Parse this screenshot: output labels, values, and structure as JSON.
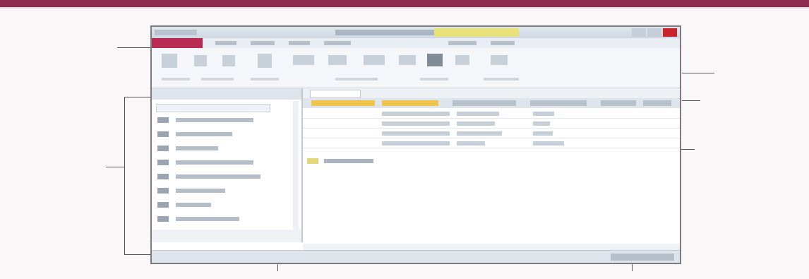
{
  "window": {
    "title": "",
    "file_tab": "",
    "ribbon_tabs": [
      "",
      "",
      "",
      "",
      "",
      ""
    ],
    "window_buttons": [
      "minimize",
      "maximize",
      "close"
    ]
  },
  "annotations": {
    "top_left": "",
    "top_right": "",
    "file_tab": "",
    "ribbon": "",
    "document_tab": "",
    "navigation_pane": "",
    "datasheet": "",
    "status_bar": "",
    "view_buttons": ""
  },
  "navigation_pane": {
    "header": "",
    "search_placeholder": "",
    "items": [
      "",
      "",
      "",
      "",
      "",
      "",
      "",
      ""
    ],
    "footer": ""
  },
  "datasheet": {
    "columns": [
      "",
      "",
      "",
      "",
      "",
      ""
    ],
    "rows": [
      [
        "",
        "",
        "",
        "",
        "",
        ""
      ],
      [
        "",
        "",
        "",
        "",
        "",
        ""
      ],
      [
        "",
        "",
        "",
        "",
        "",
        ""
      ],
      [
        "",
        "",
        "",
        "",
        "",
        ""
      ]
    ],
    "new_record_label": ""
  },
  "icons": [
    "file-tab-icon",
    "table-icon",
    "close-icon",
    "minimize-icon",
    "maximize-icon",
    "view-datasheet-icon",
    "view-design-icon"
  ],
  "colors": {
    "title_band": "#8c2a4d",
    "file_tab": "#b92b50",
    "selected_column": "#f0c44a",
    "close_button": "#c9242b"
  }
}
